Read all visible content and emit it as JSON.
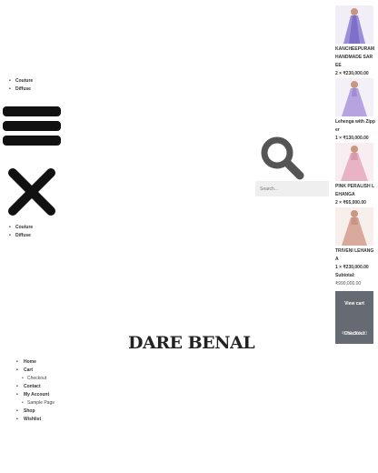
{
  "menu_top": [
    "Couture",
    "Diffuse"
  ],
  "menu_mid": [
    "Couture",
    "Diffuse"
  ],
  "search": {
    "placeholder": "Search..."
  },
  "cart": {
    "items": [
      {
        "name": "KANCHEEPURAM HANDMADE SAREE",
        "qty": "2 × ₹230,000.00",
        "thumb_color": "#9b8fd9"
      },
      {
        "name": "Lehenga with Zipper",
        "qty": "1 × ₹130,000.00",
        "thumb_color": "#b7a3e0"
      },
      {
        "name": "PINK PERALISH LEHANGA",
        "qty": "2 × ₹65,000.00",
        "thumb_color": "#e8b3c4"
      },
      {
        "name": "TRIVENI LEHANGA",
        "qty": "1 × ₹230,000.00",
        "thumb_color": "#d9a99c"
      }
    ],
    "subtotal_label": "Subtotal:",
    "subtotal_value": "₹990,000.00",
    "view_cart_label": "View cart",
    "checkout_label": "Checkout",
    "checkout_total": "₹990,000.00"
  },
  "logo": {
    "text": "DARE BENAL"
  },
  "footer_menu": {
    "home": "Home",
    "cart": "Cart",
    "checkout": "Checkout",
    "contact": "Contact",
    "my_account": "My Account",
    "sample_page": "Sample Page",
    "shop": "Shop",
    "wishlist": "Wishlist"
  },
  "colors": {
    "button_bg": "#666a73",
    "search_bg": "#efefef",
    "icon": "#111111"
  }
}
